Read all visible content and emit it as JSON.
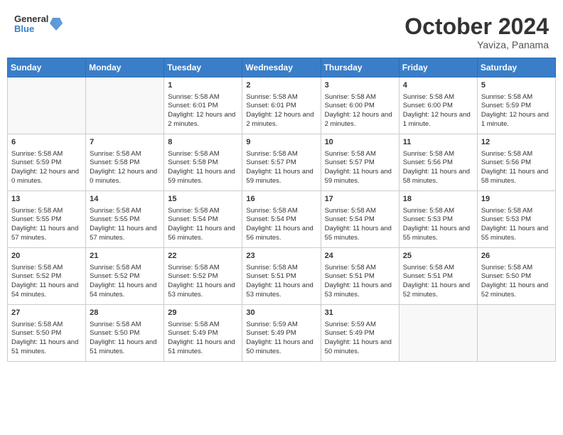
{
  "header": {
    "logo_general": "General",
    "logo_blue": "Blue",
    "month_title": "October 2024",
    "location": "Yaviza, Panama"
  },
  "weekdays": [
    "Sunday",
    "Monday",
    "Tuesday",
    "Wednesday",
    "Thursday",
    "Friday",
    "Saturday"
  ],
  "weeks": [
    [
      {
        "day": "",
        "info": ""
      },
      {
        "day": "",
        "info": ""
      },
      {
        "day": "1",
        "info": "Sunrise: 5:58 AM\nSunset: 6:01 PM\nDaylight: 12 hours and 2 minutes."
      },
      {
        "day": "2",
        "info": "Sunrise: 5:58 AM\nSunset: 6:01 PM\nDaylight: 12 hours and 2 minutes."
      },
      {
        "day": "3",
        "info": "Sunrise: 5:58 AM\nSunset: 6:00 PM\nDaylight: 12 hours and 2 minutes."
      },
      {
        "day": "4",
        "info": "Sunrise: 5:58 AM\nSunset: 6:00 PM\nDaylight: 12 hours and 1 minute."
      },
      {
        "day": "5",
        "info": "Sunrise: 5:58 AM\nSunset: 5:59 PM\nDaylight: 12 hours and 1 minute."
      }
    ],
    [
      {
        "day": "6",
        "info": "Sunrise: 5:58 AM\nSunset: 5:59 PM\nDaylight: 12 hours and 0 minutes."
      },
      {
        "day": "7",
        "info": "Sunrise: 5:58 AM\nSunset: 5:58 PM\nDaylight: 12 hours and 0 minutes."
      },
      {
        "day": "8",
        "info": "Sunrise: 5:58 AM\nSunset: 5:58 PM\nDaylight: 11 hours and 59 minutes."
      },
      {
        "day": "9",
        "info": "Sunrise: 5:58 AM\nSunset: 5:57 PM\nDaylight: 11 hours and 59 minutes."
      },
      {
        "day": "10",
        "info": "Sunrise: 5:58 AM\nSunset: 5:57 PM\nDaylight: 11 hours and 59 minutes."
      },
      {
        "day": "11",
        "info": "Sunrise: 5:58 AM\nSunset: 5:56 PM\nDaylight: 11 hours and 58 minutes."
      },
      {
        "day": "12",
        "info": "Sunrise: 5:58 AM\nSunset: 5:56 PM\nDaylight: 11 hours and 58 minutes."
      }
    ],
    [
      {
        "day": "13",
        "info": "Sunrise: 5:58 AM\nSunset: 5:55 PM\nDaylight: 11 hours and 57 minutes."
      },
      {
        "day": "14",
        "info": "Sunrise: 5:58 AM\nSunset: 5:55 PM\nDaylight: 11 hours and 57 minutes."
      },
      {
        "day": "15",
        "info": "Sunrise: 5:58 AM\nSunset: 5:54 PM\nDaylight: 11 hours and 56 minutes."
      },
      {
        "day": "16",
        "info": "Sunrise: 5:58 AM\nSunset: 5:54 PM\nDaylight: 11 hours and 56 minutes."
      },
      {
        "day": "17",
        "info": "Sunrise: 5:58 AM\nSunset: 5:54 PM\nDaylight: 11 hours and 55 minutes."
      },
      {
        "day": "18",
        "info": "Sunrise: 5:58 AM\nSunset: 5:53 PM\nDaylight: 11 hours and 55 minutes."
      },
      {
        "day": "19",
        "info": "Sunrise: 5:58 AM\nSunset: 5:53 PM\nDaylight: 11 hours and 55 minutes."
      }
    ],
    [
      {
        "day": "20",
        "info": "Sunrise: 5:58 AM\nSunset: 5:52 PM\nDaylight: 11 hours and 54 minutes."
      },
      {
        "day": "21",
        "info": "Sunrise: 5:58 AM\nSunset: 5:52 PM\nDaylight: 11 hours and 54 minutes."
      },
      {
        "day": "22",
        "info": "Sunrise: 5:58 AM\nSunset: 5:52 PM\nDaylight: 11 hours and 53 minutes."
      },
      {
        "day": "23",
        "info": "Sunrise: 5:58 AM\nSunset: 5:51 PM\nDaylight: 11 hours and 53 minutes."
      },
      {
        "day": "24",
        "info": "Sunrise: 5:58 AM\nSunset: 5:51 PM\nDaylight: 11 hours and 53 minutes."
      },
      {
        "day": "25",
        "info": "Sunrise: 5:58 AM\nSunset: 5:51 PM\nDaylight: 11 hours and 52 minutes."
      },
      {
        "day": "26",
        "info": "Sunrise: 5:58 AM\nSunset: 5:50 PM\nDaylight: 11 hours and 52 minutes."
      }
    ],
    [
      {
        "day": "27",
        "info": "Sunrise: 5:58 AM\nSunset: 5:50 PM\nDaylight: 11 hours and 51 minutes."
      },
      {
        "day": "28",
        "info": "Sunrise: 5:58 AM\nSunset: 5:50 PM\nDaylight: 11 hours and 51 minutes."
      },
      {
        "day": "29",
        "info": "Sunrise: 5:58 AM\nSunset: 5:49 PM\nDaylight: 11 hours and 51 minutes."
      },
      {
        "day": "30",
        "info": "Sunrise: 5:59 AM\nSunset: 5:49 PM\nDaylight: 11 hours and 50 minutes."
      },
      {
        "day": "31",
        "info": "Sunrise: 5:59 AM\nSunset: 5:49 PM\nDaylight: 11 hours and 50 minutes."
      },
      {
        "day": "",
        "info": ""
      },
      {
        "day": "",
        "info": ""
      }
    ]
  ]
}
